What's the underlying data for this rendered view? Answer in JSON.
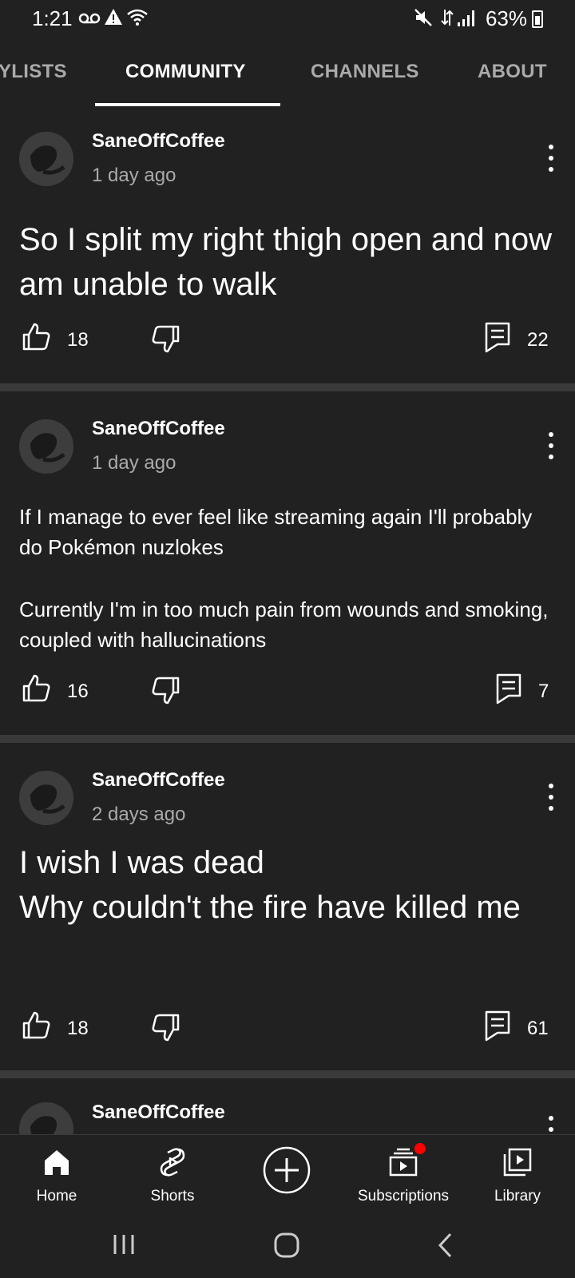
{
  "status_bar": {
    "time": "1:21",
    "battery": "63%",
    "icons": [
      "voicemail-icon",
      "warning-icon",
      "wifi-icon",
      "mute-icon",
      "data-icon",
      "signal-icon",
      "battery-icon"
    ]
  },
  "tabs": [
    {
      "label": "YLISTS",
      "active": false
    },
    {
      "label": "COMMUNITY",
      "active": true
    },
    {
      "label": "CHANNELS",
      "active": false
    },
    {
      "label": "ABOUT",
      "active": false
    }
  ],
  "posts": [
    {
      "author": "SaneOffCoffee",
      "age": "1 day ago",
      "text": "So I split my right thigh open and now am unable to walk",
      "likes": "18",
      "comments": "22"
    },
    {
      "author": "SaneOffCoffee",
      "age": "1 day ago",
      "text_lines": [
        "If I manage to ever feel like streaming again I'll probably do Pokémon nuzlokes",
        "Currently I'm in too much pain from wounds and smoking, coupled with hallucinations"
      ],
      "likes": "16",
      "comments": "7"
    },
    {
      "author": "SaneOffCoffee",
      "age": "2 days ago",
      "text_lines": [
        "I wish I was dead",
        "Why couldn't the fire have killed me"
      ],
      "likes": "18",
      "comments": "61"
    },
    {
      "author": "SaneOffCoffee"
    }
  ],
  "bottom_nav": [
    {
      "label": "Home",
      "icon": "home-icon"
    },
    {
      "label": "Shorts",
      "icon": "shorts-icon"
    },
    {
      "label": "",
      "icon": "create-icon"
    },
    {
      "label": "Subscriptions",
      "icon": "subscriptions-icon"
    },
    {
      "label": "Library",
      "icon": "library-icon"
    }
  ],
  "colors": {
    "background": "#212121",
    "separator": "#3a3a3a",
    "secondary_text": "#aaaaaa",
    "notification_dot": "#ff0000"
  }
}
